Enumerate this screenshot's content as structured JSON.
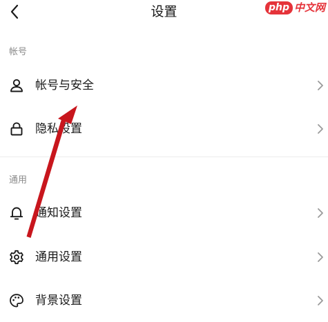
{
  "header": {
    "title": "设置",
    "back_icon": "chevron-left-icon"
  },
  "watermark": {
    "brand": "php",
    "text": "中文网"
  },
  "sections": [
    {
      "label": "帐号",
      "items": [
        {
          "label": "帐号与安全",
          "icon": "user-icon"
        },
        {
          "label": "隐私设置",
          "icon": "lock-icon"
        }
      ]
    },
    {
      "label": "通用",
      "items": [
        {
          "label": "通知设置",
          "icon": "bell-icon"
        },
        {
          "label": "通用设置",
          "icon": "gear-icon"
        },
        {
          "label": "背景设置",
          "icon": "palette-icon"
        }
      ]
    }
  ],
  "colors": {
    "annotation": "#c8161d",
    "chevron": "#9a9a9a",
    "section_label": "#8a8a8a"
  }
}
